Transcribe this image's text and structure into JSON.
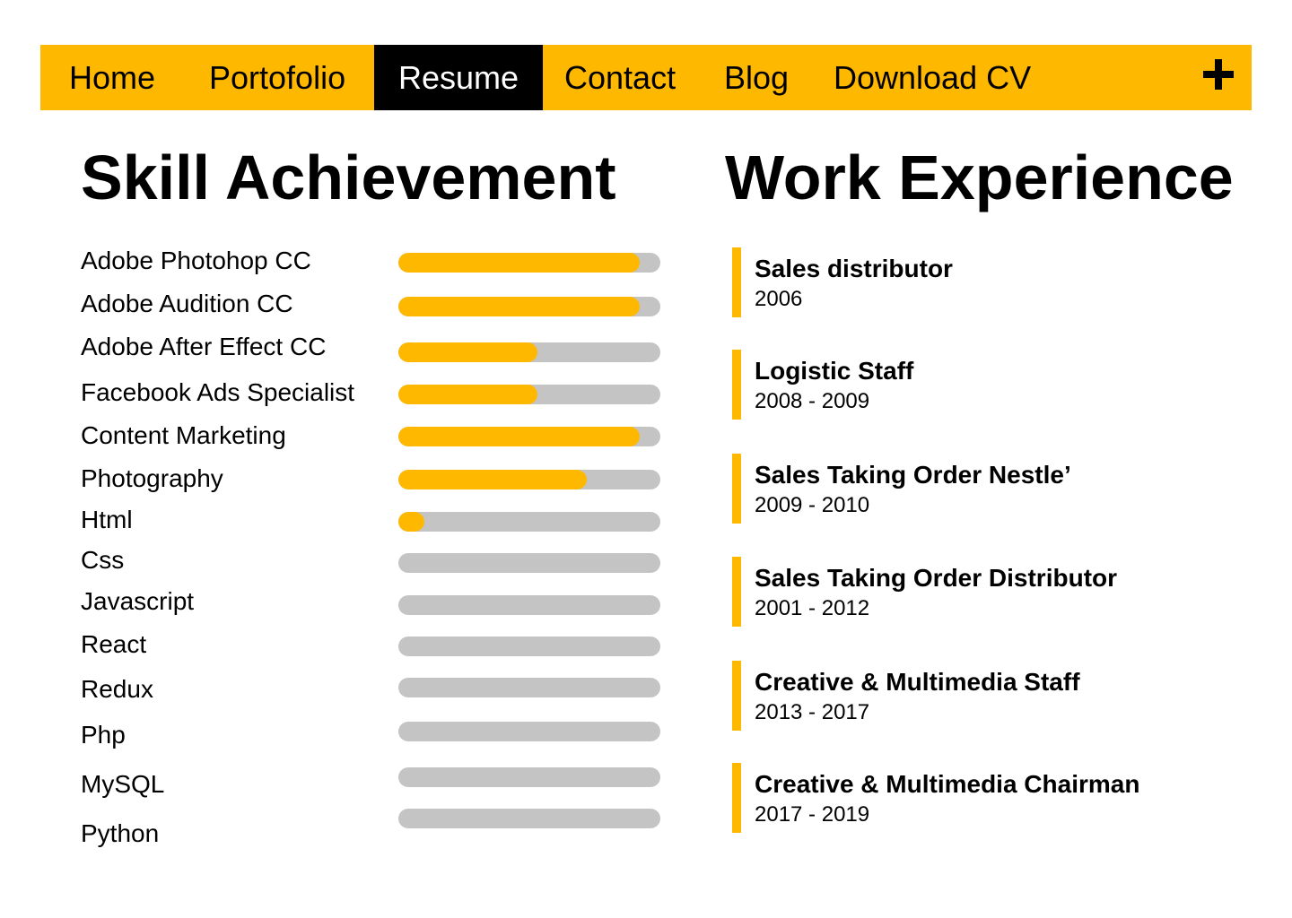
{
  "nav": {
    "items": [
      {
        "label": "Home",
        "active": false
      },
      {
        "label": "Portofolio",
        "active": false
      },
      {
        "label": "Resume",
        "active": true
      },
      {
        "label": "Contact",
        "active": false
      },
      {
        "label": "Blog",
        "active": false
      },
      {
        "label": "Download CV",
        "active": false
      }
    ],
    "add_icon": "plus-icon"
  },
  "colors": {
    "accent": "#FFB800",
    "track": "#C4C4C4",
    "active_bg": "#000000",
    "active_text": "#FFFFFF"
  },
  "skills": {
    "title": "Skill Achievement",
    "items": [
      {
        "label": "Adobe Photohop CC",
        "level": 0.92
      },
      {
        "label": "Adobe Audition CC",
        "level": 0.92
      },
      {
        "label": "Adobe After Effect CC",
        "level": 0.53
      },
      {
        "label": "Facebook Ads Specialist",
        "level": 0.53
      },
      {
        "label": "Content Marketing",
        "level": 0.92
      },
      {
        "label": "Photography",
        "level": 0.72
      },
      {
        "label": "Html",
        "level": 0.1
      },
      {
        "label": "Css",
        "level": 0
      },
      {
        "label": "Javascript",
        "level": 0
      },
      {
        "label": "React",
        "level": 0
      },
      {
        "label": "Redux",
        "level": 0
      },
      {
        "label": "Php",
        "level": 0
      },
      {
        "label": "MySQL",
        "level": 0
      },
      {
        "label": "Python",
        "level": 0
      }
    ]
  },
  "experience": {
    "title": "Work Experience",
    "items": [
      {
        "title": "Sales distributor",
        "years": "2006"
      },
      {
        "title": "Logistic Staff",
        "years": "2008 - 2009"
      },
      {
        "title": "Sales Taking Order Nestle’",
        "years": "2009 - 2010"
      },
      {
        "title": "Sales Taking Order Distributor",
        "years": "2001 - 2012"
      },
      {
        "title": "Creative & Multimedia Staff",
        "years": "2013 - 2017"
      },
      {
        "title": "Creative & Multimedia Chairman",
        "years": "2017 - 2019"
      }
    ]
  }
}
